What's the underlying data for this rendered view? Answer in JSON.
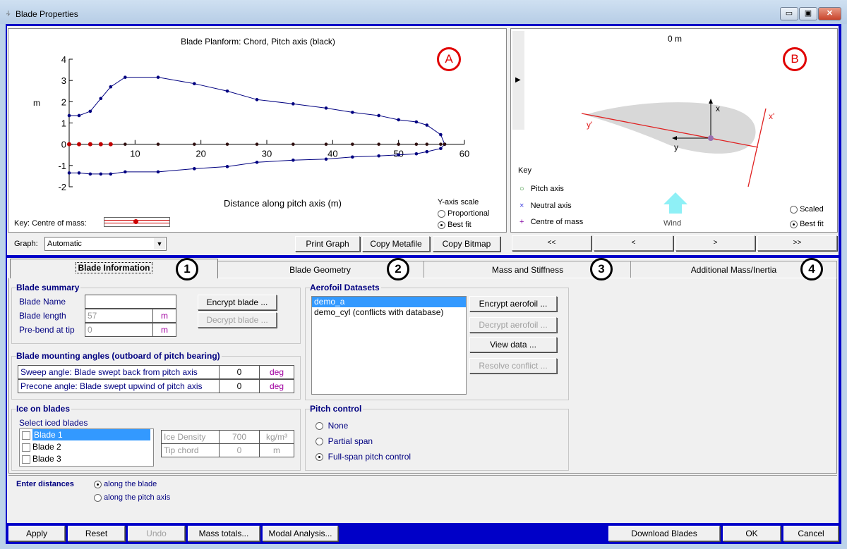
{
  "window": {
    "title": "Blade Properties",
    "icon": "turbine-icon",
    "controls": [
      "minimize",
      "maximize",
      "close"
    ]
  },
  "graph_panel": {
    "annotation": "A",
    "key_label": "Key: Centre of mass:",
    "yscale": {
      "title": "Y-axis scale",
      "options": [
        "Proportional",
        "Best fit"
      ],
      "selected": "Best fit"
    },
    "graph_label": "Graph:",
    "graph_select": "Automatic",
    "buttons": [
      "Print Graph",
      "Copy Metafile",
      "Copy Bitmap"
    ]
  },
  "chart_data": {
    "type": "line",
    "title": "Blade Planform: Chord, Pitch axis (black)",
    "xlabel": "Distance along pitch axis (m)",
    "ylabel": "m",
    "xlim": [
      0,
      60
    ],
    "ylim": [
      -2,
      4
    ],
    "xticks": [
      10,
      20,
      30,
      40,
      50,
      60
    ],
    "yticks": [
      -2,
      -1,
      0,
      1,
      2,
      3,
      4
    ],
    "grid": false,
    "x": [
      0,
      1.5,
      3.2,
      4.8,
      6.3,
      8.5,
      13.5,
      19,
      24,
      28.5,
      34,
      39,
      43,
      47,
      50,
      52.7,
      54.3,
      56.4,
      57
    ],
    "series": [
      {
        "name": "leading edge",
        "color": "#000080",
        "values": [
          1.35,
          1.35,
          1.55,
          2.15,
          2.7,
          3.15,
          3.15,
          2.85,
          2.5,
          2.1,
          1.9,
          1.7,
          1.5,
          1.35,
          1.15,
          1.05,
          0.9,
          0.45,
          0
        ]
      },
      {
        "name": "trailing edge",
        "color": "#000080",
        "values": [
          -1.35,
          -1.35,
          -1.4,
          -1.4,
          -1.4,
          -1.3,
          -1.3,
          -1.15,
          -1.05,
          -0.85,
          -0.75,
          -0.7,
          -0.6,
          -0.55,
          -0.5,
          -0.45,
          -0.35,
          -0.2,
          0
        ]
      },
      {
        "name": "pitch axis",
        "color": "#000000",
        "values": [
          0,
          0,
          0,
          0,
          0,
          0,
          0,
          0,
          0,
          0,
          0,
          0,
          0,
          0,
          0,
          0,
          0,
          0,
          0
        ]
      }
    ],
    "centre_of_mass_x": [
      0,
      1.5,
      3.2,
      4.8,
      6.3
    ],
    "centre_of_mass_color": "#c00000"
  },
  "section_panel": {
    "annotation": "B",
    "station": "0 m",
    "key_title": "Key",
    "key": [
      {
        "label": "Pitch axis",
        "symbol": "○",
        "color": "#2a8a2a"
      },
      {
        "label": "Neutral axis",
        "symbol": "×",
        "color": "#4040e0"
      },
      {
        "label": "Centre of mass",
        "symbol": "+",
        "color": "#8000a0"
      }
    ],
    "axes": {
      "x": "x",
      "y": "y",
      "xp": "x'",
      "yp": "y'"
    },
    "wind_label": "Wind",
    "scale_options": [
      "Scaled",
      "Best fit"
    ],
    "scale_selected": "Best fit",
    "nav": [
      "<<",
      "<",
      ">",
      ">>"
    ]
  },
  "tabs": [
    {
      "label": "Blade Information",
      "annotation": "1",
      "active": true
    },
    {
      "label": "Blade Geometry",
      "annotation": "2"
    },
    {
      "label": "Mass and Stiffness",
      "annotation": "3"
    },
    {
      "label": "Additional Mass/Inertia",
      "annotation": "4"
    }
  ],
  "blade_summary": {
    "title": "Blade summary",
    "name_label": "Blade Name",
    "name_value": "",
    "length_label": "Blade length",
    "length_value": "57",
    "length_unit": "m",
    "prebend_label": "Pre-bend at tip",
    "prebend_value": "0",
    "prebend_unit": "m",
    "encrypt": "Encrypt blade ...",
    "decrypt": "Decrypt blade ..."
  },
  "mounting": {
    "title": "Blade mounting angles (outboard of pitch bearing)",
    "rows": [
      {
        "label": "Sweep angle: Blade swept back from pitch axis",
        "value": "0",
        "unit": "deg"
      },
      {
        "label": "Precone angle: Blade swept upwind of pitch axis",
        "value": "0",
        "unit": "deg"
      }
    ]
  },
  "ice": {
    "title": "Ice on blades",
    "select_label": "Select iced blades",
    "blades": [
      "Blade 1",
      "Blade 2",
      "Blade 3"
    ],
    "density_label": "Ice Density",
    "density_value": "700",
    "density_unit": "kg/m³",
    "tip_label": "Tip chord",
    "tip_value": "0",
    "tip_unit": "m"
  },
  "aerofoil": {
    "title": "Aerofoil Datasets",
    "items": [
      "demo_a",
      "demo_cyl (conflicts with database)"
    ],
    "selected": "demo_a",
    "buttons": [
      "Encrypt aerofoil ...",
      "Decrypt aerofoil ...",
      "View data ...",
      "Resolve conflict ..."
    ]
  },
  "pitch": {
    "title": "Pitch control",
    "options": [
      "None",
      "Partial span",
      "Full-span pitch control"
    ],
    "selected": "Full-span pitch control"
  },
  "distances": {
    "label": "Enter distances",
    "options": [
      "along the blade",
      "along the pitch axis"
    ],
    "selected": "along the blade"
  },
  "footer": {
    "left": [
      "Apply",
      "Reset",
      "Undo",
      "Mass totals...",
      "Modal Analysis..."
    ],
    "right": [
      "Download Blades",
      "OK",
      "Cancel"
    ]
  }
}
